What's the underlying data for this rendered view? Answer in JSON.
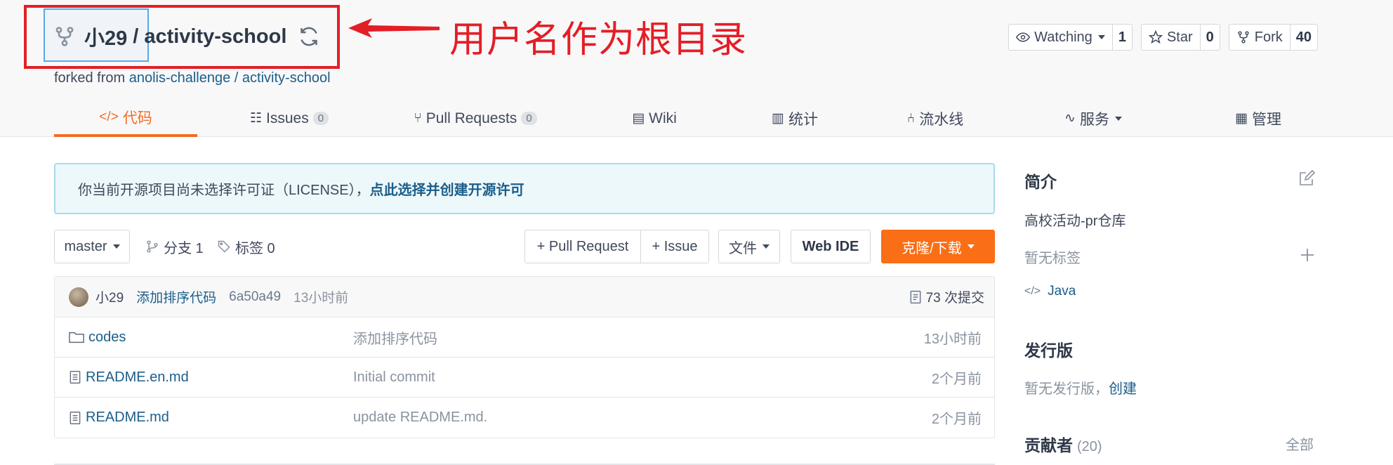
{
  "repo": {
    "owner": "小29",
    "separator": "/",
    "name": "activity-school",
    "forked_prefix": "forked from ",
    "forked_source": "anolis-challenge / activity-school"
  },
  "annotation": {
    "text": "用户名作为根目录",
    "color": "#e41e26"
  },
  "actions": {
    "watch": {
      "label": "Watching",
      "count": "1"
    },
    "star": {
      "label": "Star",
      "count": "0"
    },
    "fork": {
      "label": "Fork",
      "count": "40"
    }
  },
  "tabs": [
    {
      "icon": "</>",
      "label": "代码",
      "badge": ""
    },
    {
      "icon": "☷",
      "label": "Issues",
      "badge": "0"
    },
    {
      "icon": "⑂",
      "label": "Pull Requests",
      "badge": "0"
    },
    {
      "icon": "▤",
      "label": "Wiki",
      "badge": ""
    },
    {
      "icon": "▥",
      "label": "统计",
      "badge": ""
    },
    {
      "icon": "⑃",
      "label": "流水线",
      "badge": ""
    },
    {
      "icon": "∿",
      "label": "服务",
      "badge": ""
    },
    {
      "icon": "▦",
      "label": "管理",
      "badge": ""
    }
  ],
  "license_notice": {
    "text": "你当前开源项目尚未选择许可证（LICENSE），",
    "link": "点此选择并创建开源许可"
  },
  "toolbar": {
    "branch": "master",
    "branches_label": "分支 1",
    "tags_label": "标签 0",
    "pull_request": "+ Pull Request",
    "issue": "+ Issue",
    "file": "文件",
    "web_ide": "Web IDE",
    "clone": "克隆/下载"
  },
  "last_commit": {
    "author": "小29",
    "message": "添加排序代码",
    "sha": "6a50a49",
    "time": "13小时前",
    "commit_count": "73 次提交"
  },
  "files": [
    {
      "type": "folder",
      "name": "codes",
      "message": "添加排序代码",
      "time": "13小时前"
    },
    {
      "type": "file",
      "name": "README.en.md",
      "message": "Initial commit",
      "time": "2个月前"
    },
    {
      "type": "file",
      "name": "README.md",
      "message": "update README.md.",
      "time": "2个月前"
    }
  ],
  "sidebar": {
    "intro_title": "简介",
    "description": "高校活动-pr仓库",
    "no_tags": "暂无标签",
    "language": "Java",
    "release_title": "发行版",
    "no_release": "暂无发行版，",
    "create": "创建",
    "contributors_title": "贡献者",
    "contributors_count": "(20)",
    "all": "全部"
  },
  "colors": {
    "accent": "#fa6e16",
    "link": "#1b5e8a",
    "annotation": "#e41e26"
  }
}
